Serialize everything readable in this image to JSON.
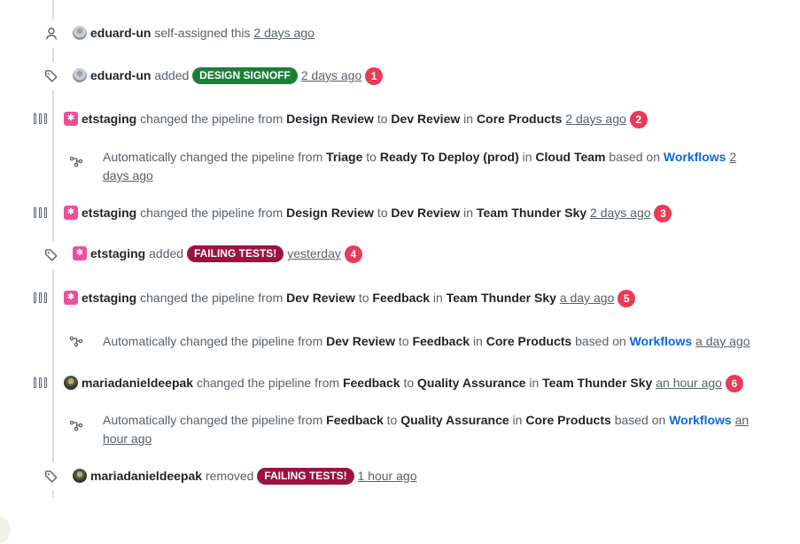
{
  "colors": {
    "green_label": "#1a7f37",
    "red_label": "#9c1340",
    "badge": "#ea3a58",
    "link": "#0969da"
  },
  "events": [
    {
      "icon": "person-icon",
      "user": "eduard-un",
      "text": "self-assigned this",
      "time": "2 days ago"
    },
    {
      "icon": "tag-icon",
      "user": "eduard-un",
      "action": "added",
      "label": "DESIGN SIGNOFF",
      "time": "2 days ago",
      "badge": "1"
    },
    {
      "icon": "pipeline-icon",
      "user": "etstaging",
      "p1": "changed the pipeline from",
      "from": "Design Review",
      "to_word": "to",
      "to": "Dev Review",
      "in_word": "in",
      "workspace": "Core Products",
      "time": "2 days ago",
      "badge": "2"
    },
    {
      "icon": "workflow-icon",
      "p1": "Automatically changed the pipeline from",
      "from": "Triage",
      "to_word": "to",
      "to": "Ready To Deploy (prod)",
      "in_word": "in",
      "workspace": "Cloud Team",
      "based": "based on",
      "link": "Workflows",
      "time": "2 days ago"
    },
    {
      "icon": "pipeline-icon",
      "user": "etstaging",
      "p1": "changed the pipeline from",
      "from": "Design Review",
      "to_word": "to",
      "to": "Dev Review",
      "in_word": "in",
      "workspace": "Team Thunder Sky",
      "time": "2 days ago",
      "badge": "3"
    },
    {
      "icon": "tag-icon",
      "user": "etstaging",
      "action": "added",
      "label": "FAILING TESTS!",
      "time": "yesterday",
      "badge": "4"
    },
    {
      "icon": "pipeline-icon",
      "user": "etstaging",
      "p1": "changed the pipeline from",
      "from": "Dev Review",
      "to_word": "to",
      "to": "Feedback",
      "in_word": "in",
      "workspace": "Team Thunder Sky",
      "time": "a day ago",
      "badge": "5"
    },
    {
      "icon": "workflow-icon",
      "p1": "Automatically changed the pipeline from",
      "from": "Dev Review",
      "to_word": "to",
      "to": "Feedback",
      "in_word": "in",
      "workspace": "Core Products",
      "based": "based on",
      "link": "Workflows",
      "time": "a day ago"
    },
    {
      "icon": "pipeline-icon",
      "user": "mariadanieldeepak",
      "p1": "changed the pipeline from",
      "from": "Feedback",
      "to_word": "to",
      "to": "Quality Assurance",
      "in_word": "in",
      "workspace": "Team Thunder Sky",
      "time": "an hour ago",
      "badge": "6"
    },
    {
      "icon": "workflow-icon",
      "p1": "Automatically changed the pipeline from",
      "from": "Feedback",
      "to_word": "to",
      "to": "Quality Assurance",
      "in_word": "in",
      "workspace": "Core Products",
      "based": "based on",
      "link": "Workflows",
      "time": "an hour ago"
    },
    {
      "icon": "tag-icon",
      "user": "mariadanieldeepak",
      "action": "removed",
      "label": "FAILING TESTS!",
      "time": "1 hour ago"
    }
  ]
}
